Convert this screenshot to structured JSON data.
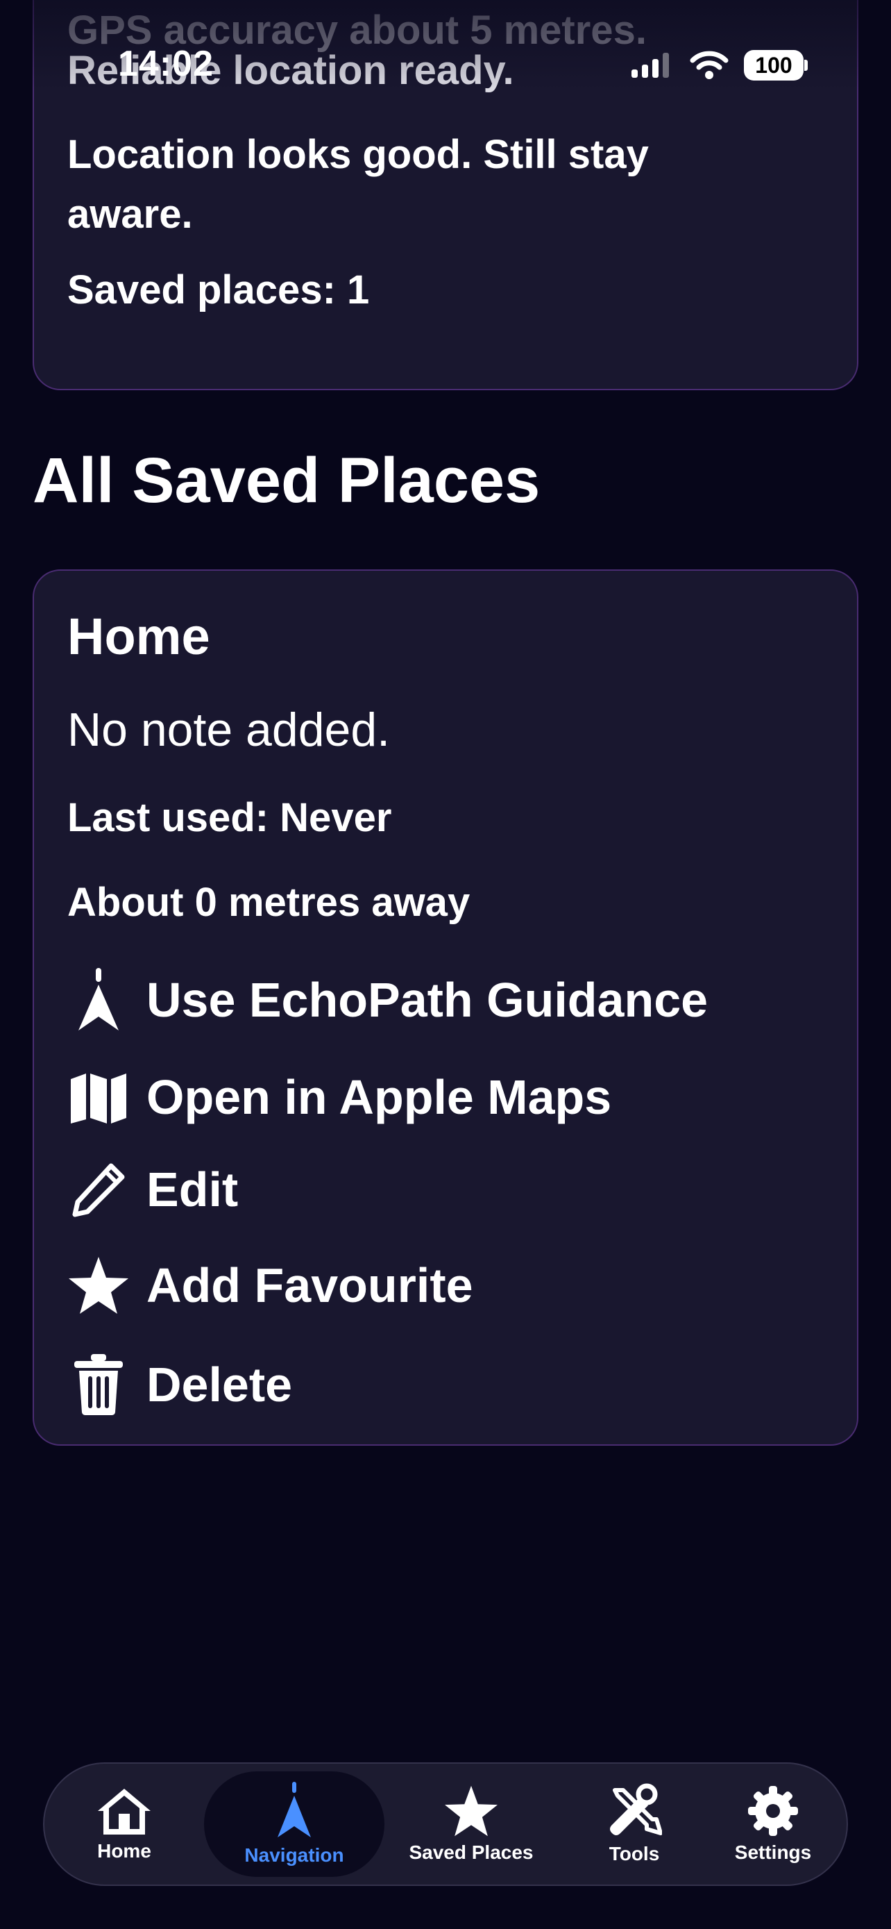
{
  "status_bar": {
    "time": "14:02",
    "battery": "100",
    "icons": [
      "cellular-signal-icon",
      "wifi-icon",
      "battery-icon"
    ]
  },
  "location_card": {
    "gps_accuracy": "GPS accuracy about 5 metres.",
    "reliable": "Reliable location ready.",
    "message": "Location looks good. Still stay aware.",
    "saved_count": "Saved places: 1"
  },
  "section_title": "All Saved Places",
  "place": {
    "name": "Home",
    "note": "No note added.",
    "last_used": "Last used: Never",
    "distance": "About 0 metres away",
    "actions": [
      {
        "label": "Use EchoPath Guidance",
        "icon": "navigation-arrow-icon"
      },
      {
        "label": "Open in Apple Maps",
        "icon": "map-icon"
      },
      {
        "label": "Edit",
        "icon": "pencil-icon"
      },
      {
        "label": "Add Favourite",
        "icon": "star-icon"
      },
      {
        "label": "Delete",
        "icon": "trash-icon"
      }
    ]
  },
  "tab_bar": {
    "active": "Navigation",
    "active_color": "#4a90ff",
    "tabs": [
      {
        "label": "Home",
        "icon": "house-icon"
      },
      {
        "label": "Navigation",
        "icon": "navigation-arrow-icon"
      },
      {
        "label": "Saved Places",
        "icon": "star-icon"
      },
      {
        "label": "Tools",
        "icon": "tools-icon"
      },
      {
        "label": "Settings",
        "icon": "gear-icon"
      }
    ]
  },
  "colors": {
    "background": "#07061a",
    "card": "#19172f",
    "card_border": "#4a2c72",
    "accent": "#4a90ff"
  }
}
